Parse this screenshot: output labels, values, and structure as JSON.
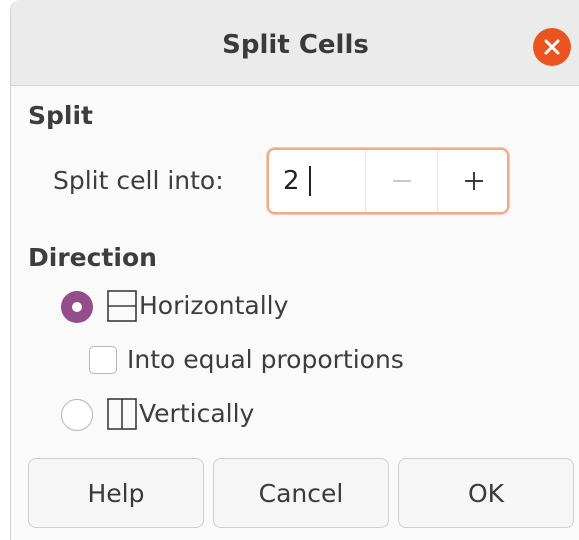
{
  "window": {
    "title": "Split Cells",
    "close_icon": "close-icon"
  },
  "split": {
    "section_label": "Split",
    "field_label": "Split cell into:",
    "value": "2",
    "decrement_icon": "minus-icon",
    "increment_icon": "plus-icon"
  },
  "direction": {
    "section_label": "Direction",
    "horizontal": {
      "label": "Horizontally",
      "checked": true,
      "icon": "split-horizontal-icon"
    },
    "equal_proportions": {
      "label": "Into equal proportions",
      "checked": false
    },
    "vertical": {
      "label": "Vertically",
      "checked": false,
      "icon": "split-vertical-icon"
    }
  },
  "buttons": {
    "help": "Help",
    "cancel": "Cancel",
    "ok": "OK"
  },
  "colors": {
    "accent_radio": "#924d8b",
    "close_button": "#e95420",
    "focus_border": "#f3a888"
  }
}
